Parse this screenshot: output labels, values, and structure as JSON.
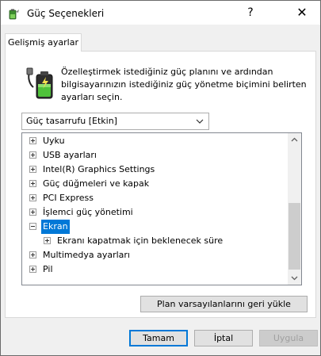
{
  "window": {
    "title": "Güç Seçenekleri",
    "help_glyph": "?",
    "close_glyph": "✕"
  },
  "tabs": [
    {
      "label": "Gelişmiş ayarlar"
    }
  ],
  "description": "Özelleştirmek istediğiniz güç planını ve ardından bilgisayarınızın istediğiniz güç yönetme biçimini belirten ayarları seçin.",
  "plan_select": {
    "value": "Güç tasarrufu [Etkin]"
  },
  "tree": {
    "items": [
      {
        "label": "Uyku",
        "expander": "plus",
        "level": 0
      },
      {
        "label": "USB ayarları",
        "expander": "plus",
        "level": 0
      },
      {
        "label": "Intel(R) Graphics Settings",
        "expander": "plus",
        "level": 0
      },
      {
        "label": "Güç düğmeleri ve kapak",
        "expander": "plus",
        "level": 0
      },
      {
        "label": "PCI Express",
        "expander": "plus",
        "level": 0
      },
      {
        "label": "İşlemci güç yönetimi",
        "expander": "plus",
        "level": 0
      },
      {
        "label": "Ekran",
        "expander": "minus",
        "level": 0,
        "selected": true
      },
      {
        "label": "Ekranı kapatmak için beklenecek süre",
        "expander": "plus",
        "level": 1
      },
      {
        "label": "Multimedya ayarları",
        "expander": "plus",
        "level": 0
      },
      {
        "label": "Pil",
        "expander": "plus",
        "level": 0
      }
    ]
  },
  "buttons": {
    "restore_label": "Plan varsayılanlarını geri yükle",
    "ok_label": "Tamam",
    "cancel_label": "İptal",
    "apply_label": "Uygula"
  },
  "colors": {
    "selection": "#0078d7",
    "dialog_bg": "#f0f0f0",
    "panel_bg": "#ffffff"
  },
  "icons": {
    "title": "power-options-icon",
    "header": "battery-plug-icon"
  }
}
